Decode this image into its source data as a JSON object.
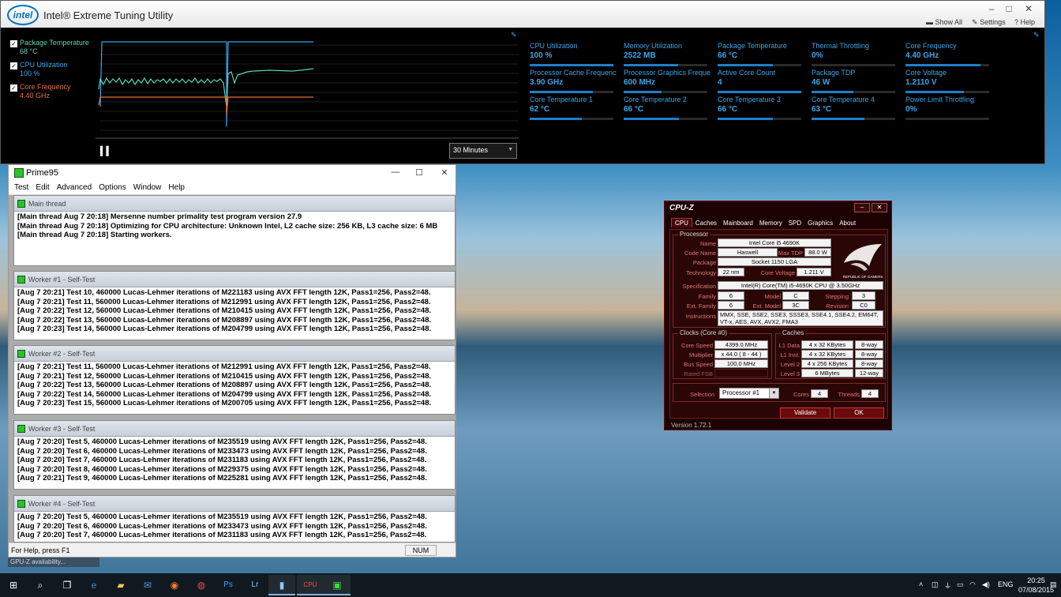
{
  "xtu": {
    "title": "Intel® Extreme Tuning Utility",
    "logo_text": "intel",
    "show_all": "Show All",
    "settings": "Settings",
    "help": "Help",
    "legend": [
      {
        "label": "Package Temperature",
        "value": "68 °C",
        "color": "#56d6b4"
      },
      {
        "label": "CPU Utilization",
        "value": "100 %",
        "color": "#3da6e8"
      },
      {
        "label": "Core Frequency",
        "value": "4.40 GHz",
        "color": "#e8723a"
      }
    ],
    "time_range": "30 Minutes",
    "metrics": [
      {
        "label": "CPU Utilization",
        "value": "100 %",
        "fill": 1.0
      },
      {
        "label": "Memory Utilization",
        "value": "2522  MB",
        "fill": 0.65
      },
      {
        "label": "Package Temperature",
        "value": "66 °C",
        "fill": 0.66
      },
      {
        "label": "Thermal Throttling",
        "value": "0%",
        "fill": 0.0
      },
      {
        "label": "Core Frequency",
        "value": "4.40 GHz",
        "fill": 0.9
      },
      {
        "label": "Processor Cache Frequency",
        "value": "3.90 GHz",
        "fill": 0.75
      },
      {
        "label": "Processor Graphics Freque...",
        "value": "600 MHz",
        "fill": 0.45
      },
      {
        "label": "Active Core Count",
        "value": "4",
        "fill": 1.0
      },
      {
        "label": "Package TDP",
        "value": "46 W",
        "fill": 0.5
      },
      {
        "label": "Core Voltage",
        "value": "1.2110 V",
        "fill": 0.7
      },
      {
        "label": "Core Temperature 1",
        "value": "62 °C",
        "fill": 0.62
      },
      {
        "label": "Core Temperature 2",
        "value": "66 °C",
        "fill": 0.66
      },
      {
        "label": "Core Temperature 3",
        "value": "66 °C",
        "fill": 0.66
      },
      {
        "label": "Core Temperature 4",
        "value": "63 °C",
        "fill": 0.63
      },
      {
        "label": "Power Limit Throttling",
        "value": "0%",
        "fill": 0.0
      }
    ]
  },
  "prime": {
    "title": "Prime95",
    "menu": [
      "Test",
      "Edit",
      "Advanced",
      "Options",
      "Window",
      "Help"
    ],
    "main_title": "Main thread",
    "main_lines": [
      "[Main thread Aug 7 20:18] Mersenne number primality test program version 27.9",
      "[Main thread Aug 7 20:18] Optimizing for CPU architecture: Unknown Intel, L2 cache size: 256 KB, L3 cache size: 6 MB",
      "[Main thread Aug 7 20:18] Starting workers."
    ],
    "workers": [
      {
        "title": "Worker #1 - Self-Test",
        "lines": [
          "[Aug 7 20:21] Test 10, 460000 Lucas-Lehmer iterations of M221183 using AVX FFT length 12K, Pass1=256, Pass2=48.",
          "[Aug 7 20:21] Test 11, 560000 Lucas-Lehmer iterations of M212991 using AVX FFT length 12K, Pass1=256, Pass2=48.",
          "[Aug 7 20:22] Test 12, 560000 Lucas-Lehmer iterations of M210415 using AVX FFT length 12K, Pass1=256, Pass2=48.",
          "[Aug 7 20:22] Test 13, 560000 Lucas-Lehmer iterations of M208897 using AVX FFT length 12K, Pass1=256, Pass2=48.",
          "[Aug 7 20:23] Test 14, 560000 Lucas-Lehmer iterations of M204799 using AVX FFT length 12K, Pass1=256, Pass2=48."
        ]
      },
      {
        "title": "Worker #2 - Self-Test",
        "lines": [
          "[Aug 7 20:21] Test 11, 560000 Lucas-Lehmer iterations of M212991 using AVX FFT length 12K, Pass1=256, Pass2=48.",
          "[Aug 7 20:21] Test 12, 560000 Lucas-Lehmer iterations of M210415 using AVX FFT length 12K, Pass1=256, Pass2=48.",
          "[Aug 7 20:22] Test 13, 560000 Lucas-Lehmer iterations of M208897 using AVX FFT length 12K, Pass1=256, Pass2=48.",
          "[Aug 7 20:22] Test 14, 560000 Lucas-Lehmer iterations of M204799 using AVX FFT length 12K, Pass1=256, Pass2=48.",
          "[Aug 7 20:23] Test 15, 560000 Lucas-Lehmer iterations of M200705 using AVX FFT length 12K, Pass1=256, Pass2=48."
        ]
      },
      {
        "title": "Worker #3 - Self-Test",
        "lines": [
          "[Aug 7 20:20] Test 5, 460000 Lucas-Lehmer iterations of M235519 using AVX FFT length 12K, Pass1=256, Pass2=48.",
          "[Aug 7 20:20] Test 6, 460000 Lucas-Lehmer iterations of M233473 using AVX FFT length 12K, Pass1=256, Pass2=48.",
          "[Aug 7 20:20] Test 7, 460000 Lucas-Lehmer iterations of M231183 using AVX FFT length 12K, Pass1=256, Pass2=48.",
          "[Aug 7 20:20] Test 8, 460000 Lucas-Lehmer iterations of M229375 using AVX FFT length 12K, Pass1=256, Pass2=48.",
          "[Aug 7 20:21] Test 9, 460000 Lucas-Lehmer iterations of M225281 using AVX FFT length 12K, Pass1=256, Pass2=48."
        ]
      },
      {
        "title": "Worker #4 - Self-Test",
        "lines": [
          "[Aug 7 20:20] Test 5, 460000 Lucas-Lehmer iterations of M235519 using AVX FFT length 12K, Pass1=256, Pass2=48.",
          "[Aug 7 20:20] Test 6, 460000 Lucas-Lehmer iterations of M233473 using AVX FFT length 12K, Pass1=256, Pass2=48.",
          "[Aug 7 20:20] Test 7, 460000 Lucas-Lehmer iterations of M231183 using AVX FFT length 12K, Pass1=256, Pass2=48."
        ]
      }
    ],
    "status_help": "For Help, press F1",
    "status_num": "NUM"
  },
  "cpuz": {
    "title": "CPU-Z",
    "tabs": [
      "CPU",
      "Caches",
      "Mainboard",
      "Memory",
      "SPD",
      "Graphics",
      "About"
    ],
    "processor_group": "Processor",
    "name_label": "Name",
    "name": "Intel Core i5 4690K",
    "codename_label": "Code Name",
    "codename": "Haswell",
    "maxtdp_label": "Max TDP",
    "maxtdp": "88.0 W",
    "package_label": "Package",
    "package": "Socket 1150 LGA",
    "technology_label": "Technology",
    "technology": "22 nm",
    "corevoltage_label": "Core Voltage",
    "corevoltage": "1.211 V",
    "spec_label": "Specification",
    "spec": "Intel(R) Core(TM) i5-4690K CPU @ 3.50GHz",
    "family_label": "Family",
    "family": "6",
    "model_label": "Model",
    "model": "C",
    "stepping_label": "Stepping",
    "stepping": "3",
    "extfamily_label": "Ext. Family",
    "extfamily": "6",
    "extmodel_label": "Ext. Model",
    "extmodel": "3C",
    "revision_label": "Revision",
    "revision": "C0",
    "instructions_label": "Instructions",
    "instructions": "MMX, SSE, SSE2, SSE3, SSSE3, SSE4.1, SSE4.2, EM64T, VT-x, AES, AVX, AVX2, FMA3",
    "clocks_group": "Clocks (Core #0)",
    "corespeed_label": "Core Speed",
    "corespeed": "4399.0 MHz",
    "multiplier_label": "Multiplier",
    "multiplier": "x 44.0 ( 8 - 44 )",
    "busspeed_label": "Bus Speed",
    "busspeed": "100.0 MHz",
    "ratedfsb_label": "Rated FSB",
    "caches_group": "Caches",
    "l1d_label": "L1 Data",
    "l1d": "4 x 32 KBytes",
    "l1d_way": "8-way",
    "l1i_label": "L1 Inst.",
    "l1i": "4 x 32 KBytes",
    "l1i_way": "8-way",
    "l2_label": "Level 2",
    "l2": "4 x 256 KBytes",
    "l2_way": "8-way",
    "l3_label": "Level 3",
    "l3": "6 MBytes",
    "l3_way": "12-way",
    "selection_label": "Selection",
    "selection": "Processor #1",
    "cores_label": "Cores",
    "cores": "4",
    "threads_label": "Threads",
    "threads": "4",
    "validate": "Validate",
    "ok": "OK",
    "version": "Version 1.72.1",
    "rog_text": "REPUBLIC OF GAMERS"
  },
  "behind_text": "GPU-Z    availability...",
  "taskbar": {
    "time": "20:25",
    "date": "07/08/2015",
    "lang": "ENG"
  }
}
